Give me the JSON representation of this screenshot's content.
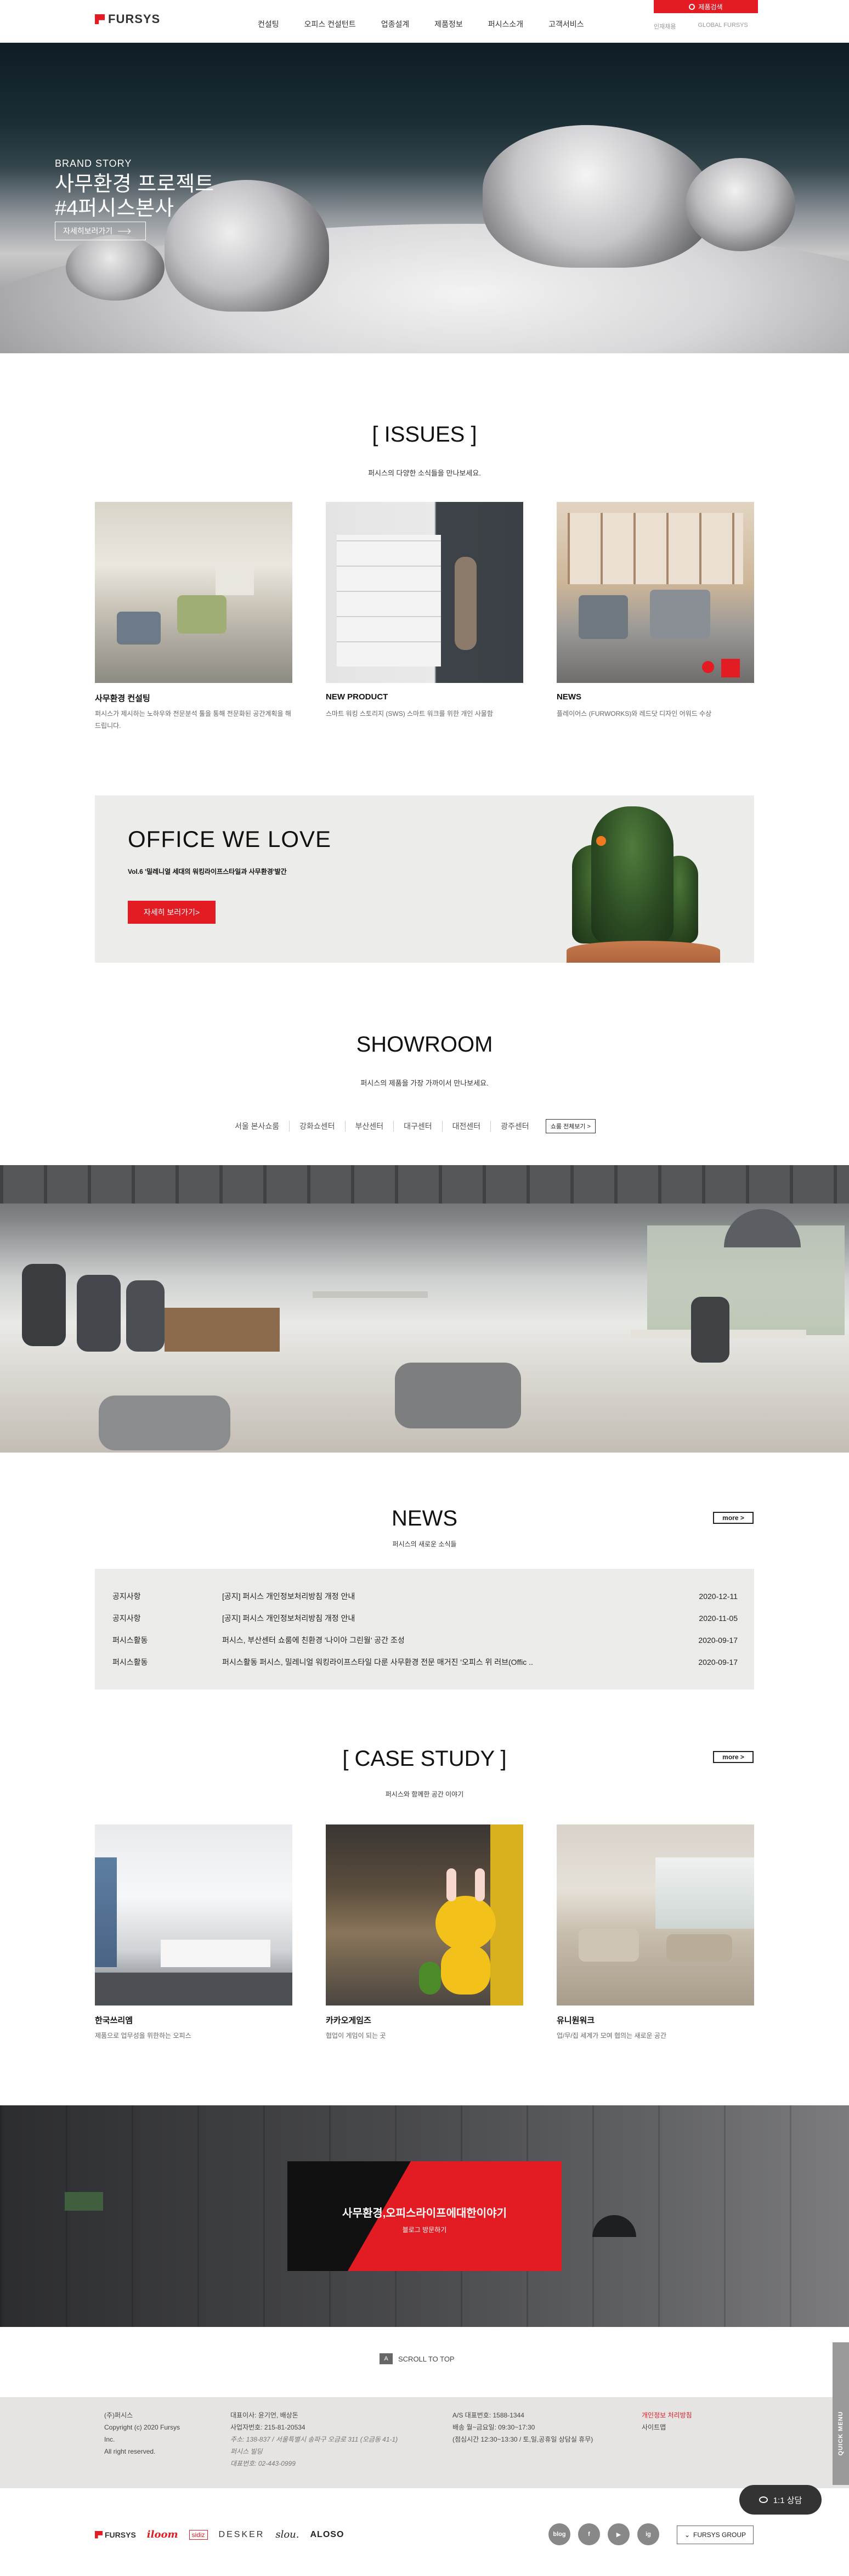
{
  "header": {
    "logo": "FURSYS",
    "nav": [
      "컨설팅",
      "오피스 컨설턴트",
      "업종설계",
      "제품정보",
      "퍼시스소개",
      "고객서비스"
    ],
    "shop_label": "제품검색",
    "util_links": [
      "인재채용",
      "GLOBAL FURSYS"
    ]
  },
  "hero": {
    "subtitle": "BRAND STORY",
    "title_line1": "사무환경 프로젝트",
    "title_line2": "#4퍼시스본사",
    "button": "자세히보러가기"
  },
  "issues": {
    "title": "[ ISSUES ]",
    "desc": "퍼시스의 다양한 소식들을 만나보세요.",
    "cards": [
      {
        "title": "사무환경 컨설팅",
        "desc": "퍼시스가 제시하는 노하우와 전문분석 툴을 통해 전문화된 공간계획을 해 드립니다."
      },
      {
        "title": "NEW PRODUCT",
        "desc": "스마트 워킹 스토리지 (SWS) 스마트 워크를 위한 개인 사물함"
      },
      {
        "title": "NEWS",
        "desc": "플레이어스 (FURWORKS)와 레드닷 디자인 어워드 수상"
      }
    ]
  },
  "owl": {
    "title": "OFFICE WE LOVE",
    "sub": "Vol.6 '밀레니얼 세대의 워킹라이프스타일과 사무환경'발간",
    "button": "자세히 보러가기>"
  },
  "showroom": {
    "title": "SHOWROOM",
    "desc": "퍼시스의 제품을 가장 가까이서 만나보세요.",
    "tabs": [
      "서울 본사쇼룸",
      "강화쇼센터",
      "부산센터",
      "대구센터",
      "대전센터",
      "광주센터"
    ],
    "all_button": "쇼룸 전체보기 >"
  },
  "news": {
    "title": "NEWS",
    "desc": "퍼시스의 새로운 소식들",
    "more": "more >",
    "rows": [
      {
        "cat": "공지사항",
        "title": "[공지] 퍼시스 개인정보처리방침 개정 안내",
        "date": "2020-12-11"
      },
      {
        "cat": "공지사항",
        "title": "[공지] 퍼시스 개인정보처리방침 개정 안내",
        "date": "2020-11-05"
      },
      {
        "cat": "퍼시스활동",
        "title": "퍼시스, 부산센터 쇼룸에 친환경 '나이아 그린월' 공간 조성",
        "date": "2020-09-17"
      },
      {
        "cat": "퍼시스활동",
        "title": "퍼시스활동 퍼시스, 밀레니얼 워킹라이프스타일 다룬 사무환경 전문 매거진 '오피스 위 러브(Offic ..",
        "date": "2020-09-17"
      }
    ]
  },
  "case_study": {
    "title": "[ CASE STUDY ]",
    "desc": "퍼시스와 함께한 공간 이야기",
    "more": "more >",
    "cards": [
      {
        "title": "한국쓰리엠",
        "desc": "제품으로 업무성을 위한하는 오피스"
      },
      {
        "title": "카카오게임즈",
        "desc": "협업이 게임이 되는 곳"
      },
      {
        "title": "유니원워크",
        "desc": "업/무/집 세계가 모여 협의는 새로운 공간"
      }
    ]
  },
  "banner": {
    "text": "사무환경,오피스라이프에대한이야기",
    "link": "블로그 방문하기"
  },
  "scroll_top": {
    "icon": "A",
    "label": "SCROLL TO TOP"
  },
  "footer": {
    "col1": [
      "(주)퍼시스",
      "Copyright (c) 2020 Fursys",
      "Inc.",
      "All right reserved."
    ],
    "col2": [
      "대표이사: 윤기언, 배상돈",
      "사업자번호: 215-81-20534",
      "주소: 138-837 / 서울특별시 송파구 오금로 311 (오금동 41-1)",
      "퍼시스 빌딩",
      "대표번호: 02-443-0999"
    ],
    "col3": [
      "A/S 대표번호: 1588-1344",
      "배송 월~금요일: 09:30~17:30",
      "(점심시간 12:30~13:30 / 토,일,공휴일 상담실 휴무)"
    ],
    "col4": [
      "개인정보 처리방침",
      "사이트맵"
    ],
    "brands": [
      "FURSYS",
      "iloom",
      "sidiz",
      "DESKER",
      "slou.",
      "ALOSO"
    ],
    "sns": [
      "blog",
      "f",
      "▶",
      "ig"
    ],
    "group": "FURSYS GROUP"
  },
  "chat": {
    "label": "1:1 상담"
  },
  "quick_menu": "QUICK MENU"
}
